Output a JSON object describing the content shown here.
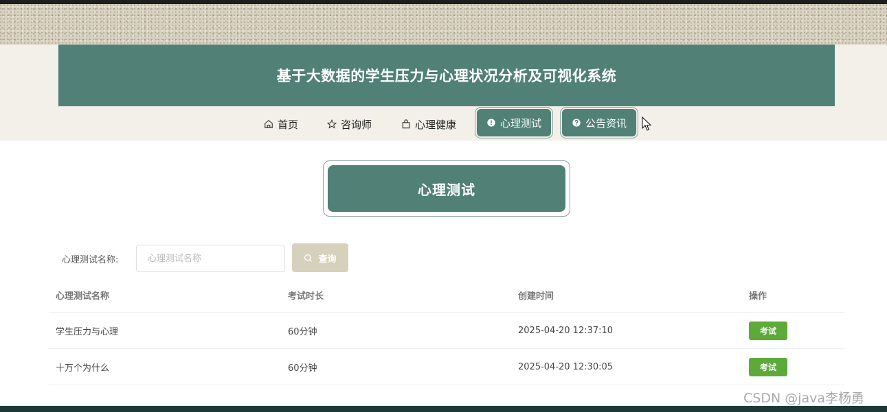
{
  "header": {
    "title": "基于大数据的学生压力与心理状况分析及可视化系统"
  },
  "nav": {
    "items": [
      {
        "label": "首页",
        "icon": "home-icon"
      },
      {
        "label": "咨询师",
        "icon": "star-icon"
      },
      {
        "label": "心理健康",
        "icon": "bag-icon"
      },
      {
        "label": "心理测试",
        "icon": "info-circle-icon"
      },
      {
        "label": "公告资讯",
        "icon": "question-circle-icon"
      }
    ]
  },
  "section": {
    "title": "心理测试"
  },
  "search": {
    "label": "心理测试名称:",
    "placeholder": "心理测试名称",
    "button_label": "查询"
  },
  "table": {
    "headers": [
      "心理测试名称",
      "考试时长",
      "创建时间",
      "操作"
    ],
    "rows": [
      {
        "name": "学生压力与心理",
        "duration": "60分钟",
        "created": "2025-04-20 12:37:10",
        "action": "考试"
      },
      {
        "name": "十万个为什么",
        "duration": "60分钟",
        "created": "2025-04-20 12:30:05",
        "action": "考试"
      }
    ]
  },
  "watermark": "CSDN @java李杨勇",
  "colors": {
    "primary": "#508076",
    "exam_button": "#5daa3a",
    "search_button": "#d6d1bc"
  }
}
